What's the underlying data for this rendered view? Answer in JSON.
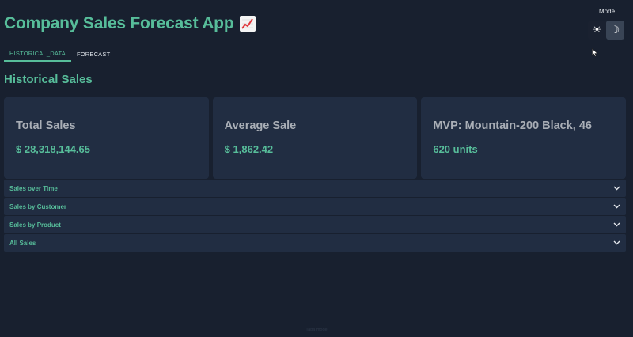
{
  "app": {
    "title": "Company Sales Forecast App",
    "title_icon": "chart-increasing-emoji"
  },
  "mode": {
    "label": "Mode",
    "light_icon": "sun-icon",
    "dark_icon": "moon-icon",
    "light_glyph": "☀",
    "dark_glyph": "☽",
    "selected": "dark"
  },
  "tabs": [
    {
      "label": "HISTORICAL_DATA",
      "active": true
    },
    {
      "label": "FORECAST",
      "active": false
    }
  ],
  "section": {
    "title": "Historical Sales"
  },
  "cards": [
    {
      "label": "Total Sales",
      "value": "$ 28,318,144.65"
    },
    {
      "label": "Average Sale",
      "value": "$ 1,862.42"
    },
    {
      "label": "MVP: Mountain-200 Black, 46",
      "value": "620 units"
    }
  ],
  "accordion": [
    {
      "label": "Sales over Time"
    },
    {
      "label": "Sales by Customer"
    },
    {
      "label": "Sales by Product"
    },
    {
      "label": "All Sales"
    }
  ],
  "footer": {
    "text": "Tapa mode"
  },
  "colors": {
    "background": "#18202f",
    "card": "#212d42",
    "accent": "#57bd9a",
    "muted_text": "#a9aeb6"
  }
}
